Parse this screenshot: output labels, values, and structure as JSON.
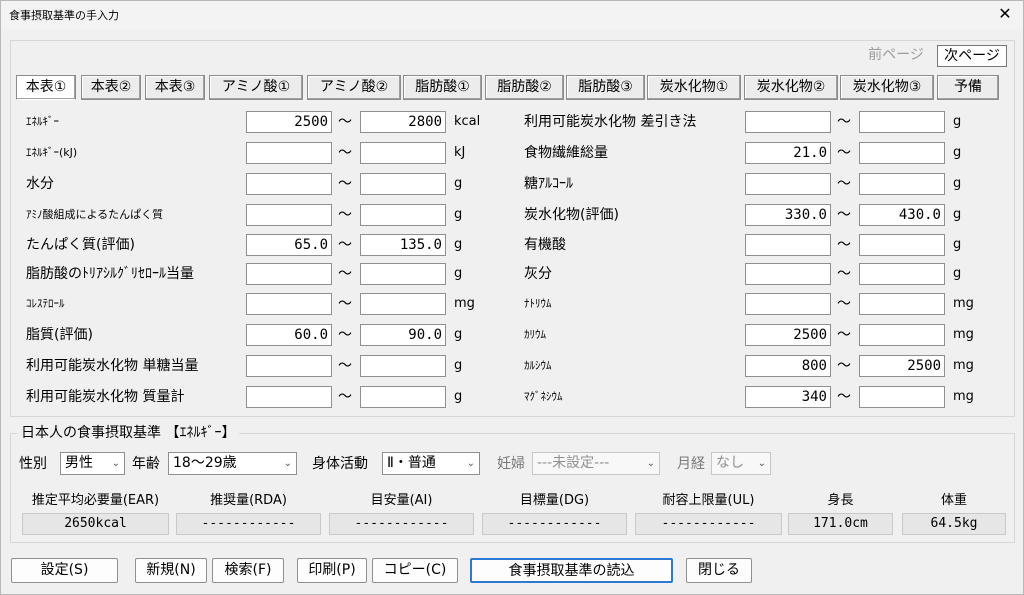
{
  "window": {
    "title": "食事摂取基準の手入力",
    "close": "✕"
  },
  "paging": {
    "prev": "前ページ",
    "next": "次ページ"
  },
  "tabs": [
    "本表①",
    "本表②",
    "本表③",
    "アミノ酸①",
    "アミノ酸②",
    "脂肪酸①",
    "脂肪酸②",
    "脂肪酸③",
    "炭水化物①",
    "炭水化物②",
    "炭水化物③",
    "予備"
  ],
  "left": [
    {
      "label": "ｴﾈﾙｷﾞｰ",
      "min": "2500",
      "max": "2800",
      "unit": "kcal"
    },
    {
      "label": "ｴﾈﾙｷﾞｰ(kJ)",
      "min": "",
      "max": "",
      "unit": "kJ"
    },
    {
      "label": "水分",
      "min": "",
      "max": "",
      "unit": "g"
    },
    {
      "label": "ｱﾐﾉ酸組成によるたんぱく質",
      "min": "",
      "max": "",
      "unit": "g"
    },
    {
      "label": "たんぱく質(評価)",
      "min": "65.0",
      "max": "135.0",
      "unit": "g"
    },
    {
      "label": "脂肪酸のﾄﾘｱｼﾙｸﾞﾘｾﾛｰﾙ当量",
      "min": "",
      "max": "",
      "unit": "g"
    },
    {
      "label": "ｺﾚｽﾃﾛｰﾙ",
      "min": "",
      "max": "",
      "unit": "mg"
    },
    {
      "label": "脂質(評価)",
      "min": "60.0",
      "max": "90.0",
      "unit": "g"
    },
    {
      "label": "利用可能炭水化物 単糖当量",
      "min": "",
      "max": "",
      "unit": "g"
    },
    {
      "label": "利用可能炭水化物 質量計",
      "min": "",
      "max": "",
      "unit": "g"
    }
  ],
  "right": [
    {
      "label": "利用可能炭水化物 差引き法",
      "min": "",
      "max": "",
      "unit": "g"
    },
    {
      "label": "食物繊維総量",
      "min": "21.0",
      "max": "",
      "unit": "g"
    },
    {
      "label": "糖ｱﾙｺｰﾙ",
      "min": "",
      "max": "",
      "unit": "g"
    },
    {
      "label": "炭水化物(評価)",
      "min": "330.0",
      "max": "430.0",
      "unit": "g"
    },
    {
      "label": "有機酸",
      "min": "",
      "max": "",
      "unit": "g"
    },
    {
      "label": "灰分",
      "min": "",
      "max": "",
      "unit": "g"
    },
    {
      "label": "ﾅﾄﾘｳﾑ",
      "min": "",
      "max": "",
      "unit": "mg"
    },
    {
      "label": "ｶﾘｳﾑ",
      "min": "2500",
      "max": "",
      "unit": "mg"
    },
    {
      "label": "ｶﾙｼｳﾑ",
      "min": "800",
      "max": "2500",
      "unit": "mg"
    },
    {
      "label": "ﾏｸﾞﾈｼｳﾑ",
      "min": "340",
      "max": "",
      "unit": "mg"
    }
  ],
  "tilde": "～",
  "standard": {
    "title": "日本人の食事摂取基準 【ｴﾈﾙｷﾞｰ】",
    "sex_label": "性別",
    "sex": "男性",
    "age_label": "年齢",
    "age": "18～29歳",
    "activity_label": "身体活動",
    "activity": "Ⅱ・普通",
    "pregnant_label": "妊婦",
    "pregnant": "---未設定---",
    "menses_label": "月経",
    "menses": "なし",
    "heads": [
      "推定平均必要量(EAR)",
      "推奨量(RDA)",
      "目安量(AI)",
      "目標量(DG)",
      "耐容上限量(UL)",
      "身長",
      "体重"
    ],
    "values": [
      "2650kcal",
      "------------",
      "------------",
      "------------",
      "------------",
      "171.0cm",
      "64.5kg"
    ]
  },
  "buttons": {
    "settings": "設定(S)",
    "new": "新規(N)",
    "search": "検索(F)",
    "print": "印刷(P)",
    "copy": "コピー(C)",
    "load": "食事摂取基準の読込",
    "close": "閉じる"
  }
}
